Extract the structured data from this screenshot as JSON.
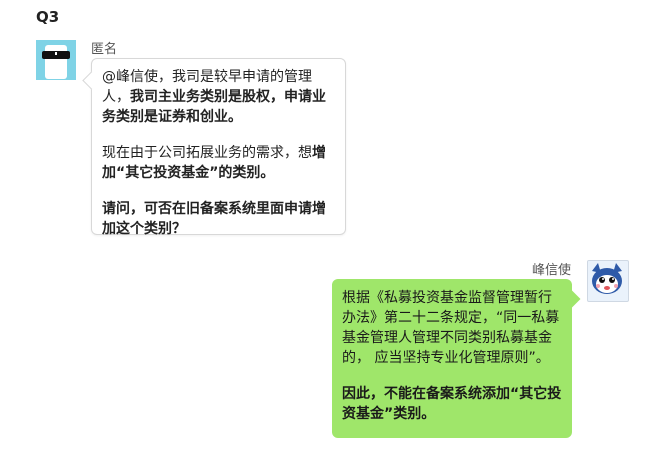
{
  "question_label": "Q3",
  "messages": [
    {
      "sender": "匿名",
      "avatar": "sunglasses-face-icon",
      "side": "left",
      "p1_a": "@峰信使，我司是较早申请的管理人，",
      "p1_b": "我司主业务类别是股权，申请业务类别是证券和创业。",
      "p2_a": "现在由于公司拓展业务的需求，想",
      "p2_b": "增加“其它投资基金”的类别。",
      "p3": "请问，可否在旧备案系统里面申请增加这个类别？"
    },
    {
      "sender": "峰信使",
      "avatar": "blue-cartoon-mascot-icon",
      "side": "right",
      "p1": "根据《私募投资基金监督管理暂行办法》第二十二条规定，“同一私募基金管理人管理不同类别私募基金 的， 应当坚持专业化管理原则”。",
      "p2": "因此，不能在备案系统添加“其它投资基金”类别。"
    }
  ],
  "colors": {
    "reply_bubble": "#9fe66a",
    "question_bubble": "#ffffff",
    "avatar_left_bg": "#7fd3e6"
  }
}
